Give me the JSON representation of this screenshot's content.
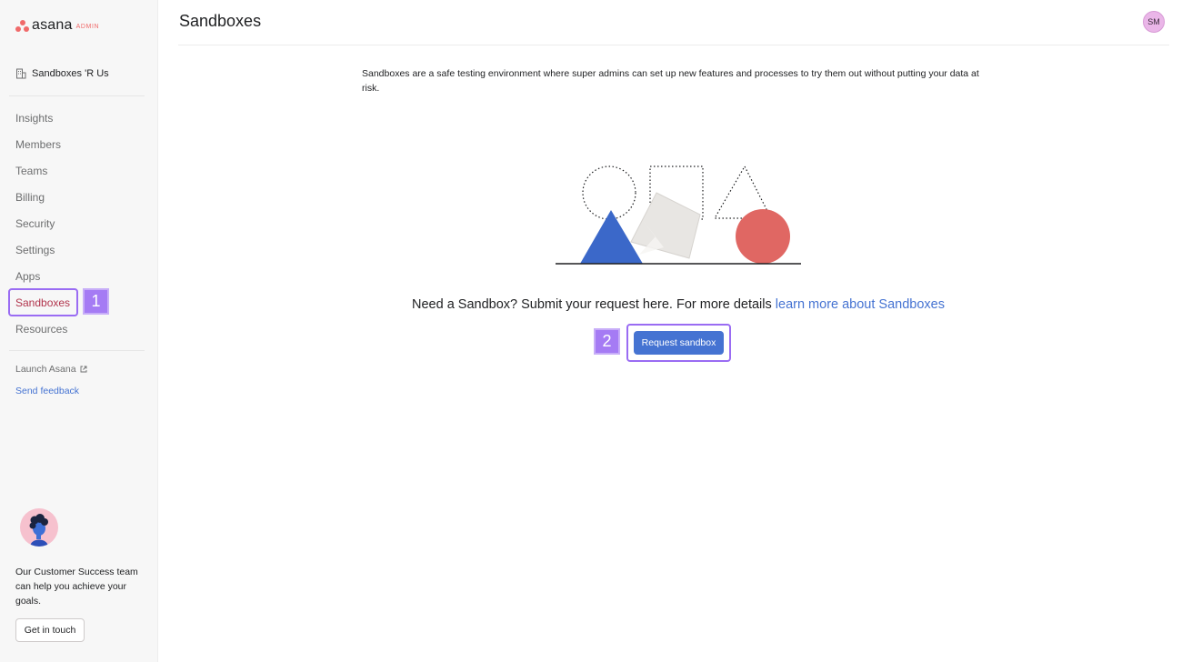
{
  "brand": {
    "wordmark": "asana",
    "badge": "ADMIN",
    "accent": "#f06a6a"
  },
  "sidebar": {
    "org_name": "Sandboxes 'R Us",
    "items": [
      {
        "label": "Insights"
      },
      {
        "label": "Members"
      },
      {
        "label": "Teams"
      },
      {
        "label": "Billing"
      },
      {
        "label": "Security"
      },
      {
        "label": "Settings"
      },
      {
        "label": "Apps"
      },
      {
        "label": "Sandboxes",
        "active": true
      },
      {
        "label": "Resources"
      }
    ],
    "launch_label": "Launch Asana",
    "feedback_label": "Send feedback",
    "customer_success": {
      "text": "Our Customer Success team can help you achieve your goals.",
      "button_label": "Get in touch"
    }
  },
  "header": {
    "title": "Sandboxes",
    "user_initials": "SM"
  },
  "main": {
    "description": "Sandboxes are a safe testing environment where super admins can set up new features and processes to try them out without putting your data at risk.",
    "cta_text": "Need a Sandbox? Submit your request here. For more details ",
    "cta_link": "learn more about Sandboxes",
    "request_button": "Request sandbox"
  },
  "annotations": {
    "step1": "1",
    "step2": "2"
  },
  "colors": {
    "active_nav": "#b1344c",
    "link": "#4573d2",
    "highlight": "#9a6cf3",
    "primary_button": "#4573d2"
  }
}
